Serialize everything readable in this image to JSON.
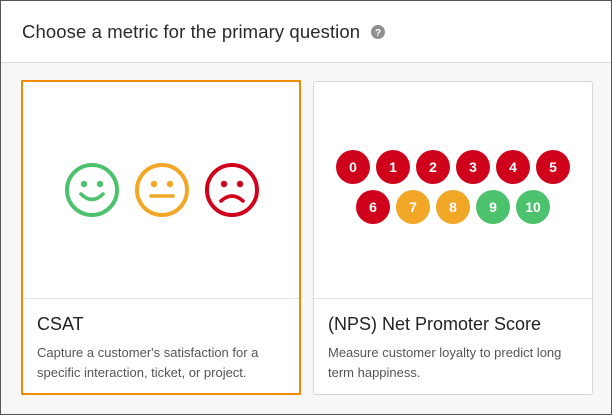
{
  "header": {
    "title": "Choose a metric for the primary question",
    "help_icon": "question-circle-icon"
  },
  "cards": [
    {
      "id": "csat",
      "title": "CSAT",
      "description": "Capture a customer's satisfaction for a specific interaction, ticket, or project.",
      "selected": true,
      "faces": [
        {
          "icon": "happy-face-icon",
          "color": "#4cc26c"
        },
        {
          "icon": "neutral-face-icon",
          "color": "#f2a626"
        },
        {
          "icon": "sad-face-icon",
          "color": "#d0021b"
        }
      ]
    },
    {
      "id": "nps",
      "title": "(NPS) Net Promoter Score",
      "description": "Measure customer loyalty to predict long term happiness.",
      "selected": false,
      "scale_row1": [
        "0",
        "1",
        "2",
        "3",
        "4",
        "5"
      ],
      "scale_row2": [
        "6",
        "7",
        "8",
        "9",
        "10"
      ]
    }
  ],
  "colors": {
    "detractor": "#d0021b",
    "passive": "#f2a626",
    "promoter": "#4cc26c",
    "selected_border": "#f08a00"
  }
}
